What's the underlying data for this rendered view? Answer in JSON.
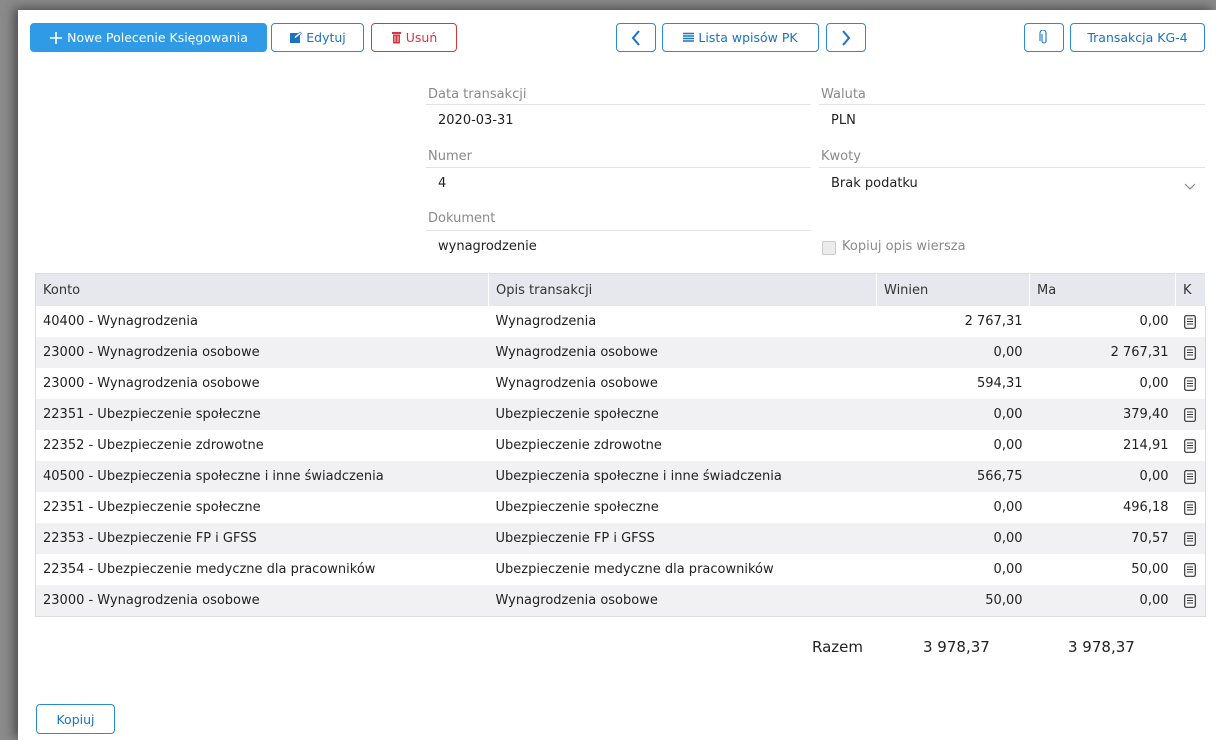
{
  "toolbar": {
    "new_label": "Nowe Polecenie Księgowania",
    "edit_label": "Edytuj",
    "delete_label": "Usuń",
    "list_label": "Lista wpisów PK",
    "transaction_label": "Transakcja KG-4"
  },
  "form": {
    "date_label": "Data transakcji",
    "date_value": "2020-03-31",
    "currency_label": "Waluta",
    "currency_value": "PLN",
    "number_label": "Numer",
    "number_value": "4",
    "amounts_label": "Kwoty",
    "amounts_value": "Brak podatku",
    "document_label": "Dokument",
    "document_value": "wynagrodzenie",
    "copy_desc_label": "Kopiuj opis wiersza"
  },
  "table": {
    "headers": {
      "account": "Konto",
      "description": "Opis transakcji",
      "debit": "Winien",
      "credit": "Ma",
      "k": "K"
    },
    "rows": [
      {
        "account": "40400 - Wynagrodzenia",
        "description": "Wynagrodzenia",
        "debit": "2 767,31",
        "credit": "0,00"
      },
      {
        "account": "23000 - Wynagrodzenia osobowe",
        "description": "Wynagrodzenia osobowe",
        "debit": "0,00",
        "credit": "2 767,31"
      },
      {
        "account": "23000 - Wynagrodzenia osobowe",
        "description": "Wynagrodzenia osobowe",
        "debit": "594,31",
        "credit": "0,00"
      },
      {
        "account": "22351 - Ubezpieczenie społeczne",
        "description": "Ubezpieczenie społeczne",
        "debit": "0,00",
        "credit": "379,40"
      },
      {
        "account": "22352 - Ubezpieczenie zdrowotne",
        "description": "Ubezpieczenie zdrowotne",
        "debit": "0,00",
        "credit": "214,91"
      },
      {
        "account": "40500 - Ubezpieczenia społeczne i inne świadczenia",
        "description": "Ubezpieczenia społeczne i inne świadczenia",
        "debit": "566,75",
        "credit": "0,00"
      },
      {
        "account": "22351 - Ubezpieczenie społeczne",
        "description": "Ubezpieczenie społeczne",
        "debit": "0,00",
        "credit": "496,18"
      },
      {
        "account": "22353 - Ubezpieczenie FP i GFSS",
        "description": "Ubezpieczenie FP i GFSS",
        "debit": "0,00",
        "credit": "70,57"
      },
      {
        "account": "22354 - Ubezpieczenie medyczne dla pracowników",
        "description": "Ubezpieczenie medyczne dla pracowników",
        "debit": "0,00",
        "credit": "50,00"
      },
      {
        "account": "23000 - Wynagrodzenia osobowe",
        "description": "Wynagrodzenia osobowe",
        "debit": "50,00",
        "credit": "0,00"
      }
    ]
  },
  "totals": {
    "label": "Razem",
    "debit": "3 978,37",
    "credit": "3 978,37"
  },
  "footer": {
    "copy_label": "Kopiuj"
  },
  "icons": {
    "plus": "plus-icon",
    "edit": "edit-icon",
    "delete": "trash-icon",
    "prev": "chevron-left-icon",
    "list": "list-icon",
    "next": "chevron-right-icon",
    "attach": "paperclip-icon",
    "dropdown": "chevron-down-icon",
    "row_doc": "document-icon"
  },
  "colors": {
    "primary": "#2f9be6",
    "danger": "#d9343f",
    "header_bg": "#e6e8ee"
  }
}
